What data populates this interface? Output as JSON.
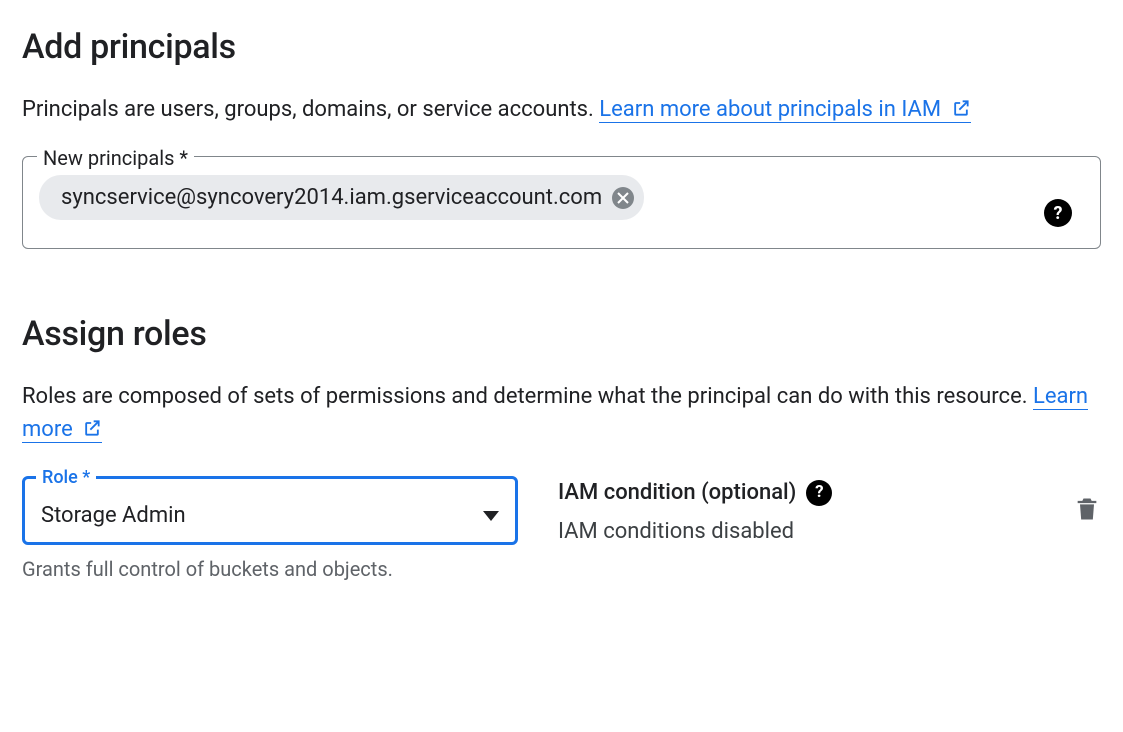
{
  "addPrincipals": {
    "title": "Add principals",
    "description": "Principals are users, groups, domains, or service accounts. ",
    "learnMoreText": "Learn more about principals in IAM",
    "fieldLabel": "New principals *",
    "chips": [
      {
        "value": "syncservice@syncovery2014.iam.gserviceaccount.com"
      }
    ]
  },
  "assignRoles": {
    "title": "Assign roles",
    "description": "Roles are composed of sets of permissions and determine what the principal can do with this resource. ",
    "learnMoreText": "Learn more",
    "roleLabel": "Role *",
    "roleValue": "Storage Admin",
    "roleHint": "Grants full control of buckets and objects.",
    "conditionTitle": "IAM condition (optional)",
    "conditionStatus": "IAM conditions disabled"
  }
}
